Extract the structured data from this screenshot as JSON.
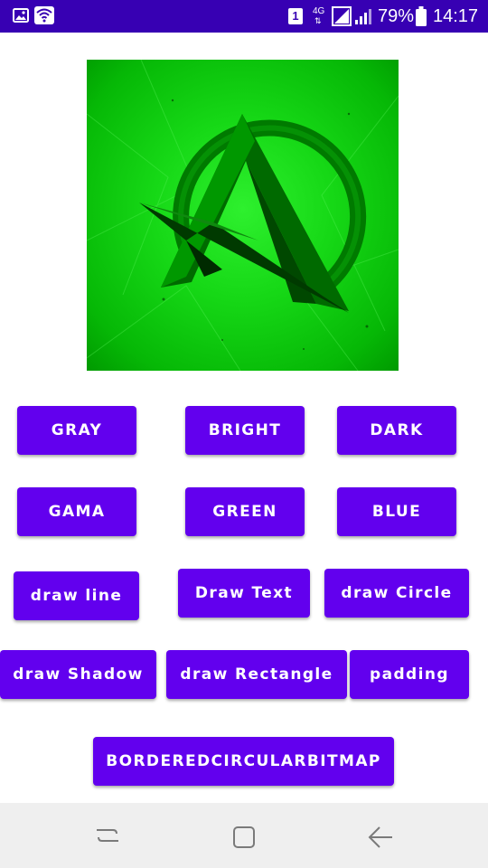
{
  "status_bar": {
    "sim_badge": "1",
    "network": "4G",
    "battery_percent": "79%",
    "time": "14:17",
    "icons": [
      "image-icon",
      "wifi-icon",
      "sim-icon",
      "network-4g-icon",
      "signal-icon",
      "battery-icon"
    ]
  },
  "image": {
    "subject": "green A logo"
  },
  "buttons": {
    "gray": "GRAY",
    "bright": "BRIGHT",
    "dark": "DARK",
    "gama": "GAMA",
    "green": "GREEN",
    "blue": "BLUE",
    "draw_line": "draw line",
    "draw_text": "Draw Text",
    "draw_circle": "draw Circle",
    "draw_shadow": "draw Shadow",
    "draw_rectangle": "draw Rectangle",
    "padding": "padding",
    "bordered_circular_bitmap": "BORDEREDCIRCULARBITMAP"
  },
  "nav_bar": {
    "icons": [
      "recent-apps-icon",
      "home-icon",
      "back-icon"
    ]
  },
  "colors": {
    "status_bar": "#3700b3",
    "button": "#6200ee",
    "nav_bar": "#efefef"
  }
}
